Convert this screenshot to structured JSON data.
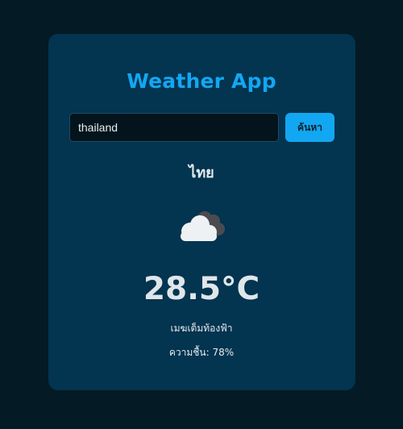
{
  "app": {
    "title": "Weather App"
  },
  "search": {
    "value": "thailand",
    "button_label": "ค้นหา"
  },
  "weather": {
    "location": "ไทย",
    "icon": "cloud-icon",
    "temperature": "28.5°C",
    "description": "เมฆเต็มท้องฟ้า",
    "humidity_label": "ความชื้น:",
    "humidity_value": "78%"
  },
  "colors": {
    "background": "#041a24",
    "card": "#033450",
    "accent": "#12a7f2"
  }
}
